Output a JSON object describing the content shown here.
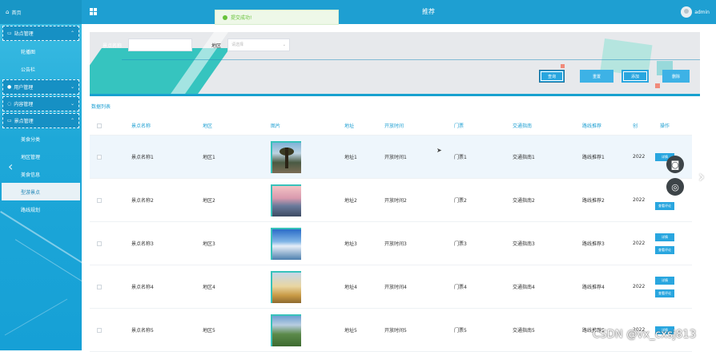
{
  "sidebar": {
    "home_label": "首页",
    "groups": [
      {
        "label": "站点管理",
        "items": [
          "轮播图",
          "公告栏"
        ]
      },
      {
        "label": "用户管理",
        "items": []
      },
      {
        "label": "内容管理",
        "items": []
      },
      {
        "label": "景点管理",
        "items": [
          "美食分类",
          "地区管理",
          "美食信息",
          "型游景点",
          "路线规划"
        ]
      }
    ],
    "active_item": "型游景点"
  },
  "topbar": {
    "title_fragment": "推荐",
    "user_name": "admin",
    "toast": "提交成功!"
  },
  "search": {
    "name_label": "景点名称",
    "name_value": "",
    "region_label": "地区",
    "region_placeholder": "请选择",
    "buttons": {
      "query": "查询",
      "reset": "重置",
      "add": "添加",
      "delete": "删除"
    }
  },
  "list_title": "数据列表",
  "table": {
    "headers": [
      "景点名称",
      "地区",
      "图片",
      "地址",
      "开放时间",
      "门票",
      "交通指南",
      "路线推荐",
      "创",
      "操作"
    ],
    "rows": [
      {
        "name": "景点名称1",
        "area": "地区1",
        "addr": "地址1",
        "time": "开放时间1",
        "ticket": "门票1",
        "traffic": "交通指南1",
        "route": "路线推荐1",
        "date": "2022"
      },
      {
        "name": "景点名称2",
        "area": "地区2",
        "addr": "地址2",
        "time": "开放时间2",
        "ticket": "门票2",
        "traffic": "交通指南2",
        "route": "路线推荐2",
        "date": "2022"
      },
      {
        "name": "景点名称3",
        "area": "地区3",
        "addr": "地址3",
        "time": "开放时间3",
        "ticket": "门票3",
        "traffic": "交通指南3",
        "route": "路线推荐3",
        "date": "2022"
      },
      {
        "name": "景点名称4",
        "area": "地区4",
        "addr": "地址4",
        "time": "开放时间4",
        "ticket": "门票4",
        "traffic": "交通指南4",
        "route": "路线推荐4",
        "date": "2022"
      },
      {
        "name": "景点名称5",
        "area": "地区5",
        "addr": "地址5",
        "time": "开放时间5",
        "ticket": "门票5",
        "traffic": "交通指南5",
        "route": "路线推荐5",
        "date": "2022"
      }
    ],
    "op_labels": {
      "detail": "详情",
      "edit": "查看评论"
    }
  },
  "watermark": "CSDN @vx_cxsj813",
  "colors": {
    "primary": "#1e9fd2",
    "sidebar": "#1ea8d8",
    "teal_accent": "#2cc2bd",
    "toast_green": "#67c23a"
  },
  "icons": {
    "home": "home-icon",
    "grid": "grid-icon",
    "camera": "camera-icon",
    "target": "target-icon"
  }
}
